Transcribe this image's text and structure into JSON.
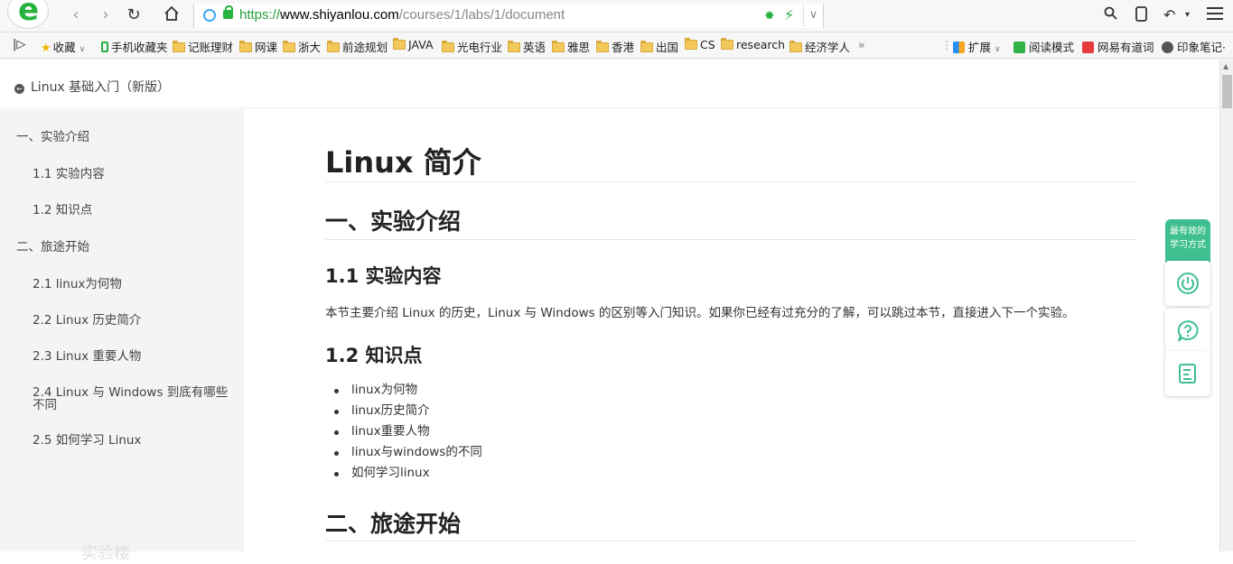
{
  "browser": {
    "logo_letter": "e",
    "url_scheme": "https://",
    "url_host": "www.shiyanlou.com",
    "url_path": "/courses/1/labs/1/document"
  },
  "bookmarks": {
    "items": [
      {
        "label": "收藏",
        "icon": "star-icon"
      },
      {
        "label": "手机收藏夹",
        "icon": "phone-icon"
      },
      {
        "label": "记账理财",
        "icon": "folder-icon"
      },
      {
        "label": "网课",
        "icon": "folder-icon"
      },
      {
        "label": "浙大",
        "icon": "folder-icon"
      },
      {
        "label": "前途规划",
        "icon": "folder-icon"
      },
      {
        "label": "JAVA",
        "icon": "folder-icon"
      },
      {
        "label": "光电行业",
        "icon": "folder-icon"
      },
      {
        "label": "英语",
        "icon": "folder-icon"
      },
      {
        "label": "雅思",
        "icon": "folder-icon"
      },
      {
        "label": "香港",
        "icon": "folder-icon"
      },
      {
        "label": "出国",
        "icon": "folder-icon"
      },
      {
        "label": "CS",
        "icon": "folder-icon"
      },
      {
        "label": "research",
        "icon": "folder-icon"
      },
      {
        "label": "经济学人",
        "icon": "folder-icon"
      }
    ],
    "more": "»",
    "extensions": "扩展",
    "reader_mode": "阅读模式",
    "youdao": "网易有道词",
    "evernote": "印象笔记·"
  },
  "course": {
    "back_label": "Linux 基础入门（新版）"
  },
  "toc": [
    {
      "label": "一、实验介绍",
      "level": 1
    },
    {
      "label": "1.1 实验内容",
      "level": 2
    },
    {
      "label": "1.2 知识点",
      "level": 2
    },
    {
      "label": "二、旅途开始",
      "level": 1
    },
    {
      "label": "2.1 linux为何物",
      "level": 2
    },
    {
      "label": "2.2 Linux 历史简介",
      "level": 2
    },
    {
      "label": "2.3 Linux 重要人物",
      "level": 2
    },
    {
      "label": "2.4 Linux 与 Windows 到底有哪些不同",
      "level": 2
    },
    {
      "label": "2.5 如何学习 Linux",
      "level": 2
    }
  ],
  "sidebar_watermark": "实验楼",
  "doc": {
    "title": "Linux 简介",
    "section1": "一、实验介绍",
    "sub1_1": "1.1 实验内容",
    "sub1_1_text": "本节主要介绍 Linux 的历史，Linux 与 Windows 的区别等入门知识。如果你已经有过充分的了解，可以跳过本节，直接进入下一个实验。",
    "sub1_2": "1.2 知识点",
    "points": [
      "linux为何物",
      "linux历史简介",
      "linux重要人物",
      "linux与windows的不同",
      "如何学习linux"
    ],
    "section2": "二、旅途开始"
  },
  "float_panel": {
    "badge_line1": "最有效的",
    "badge_line2": "学习方式",
    "buttons": [
      "power-icon",
      "help-icon",
      "notes-icon"
    ]
  },
  "colors": {
    "accent_green": "#3fbf8f",
    "browser_green": "#27b340"
  }
}
